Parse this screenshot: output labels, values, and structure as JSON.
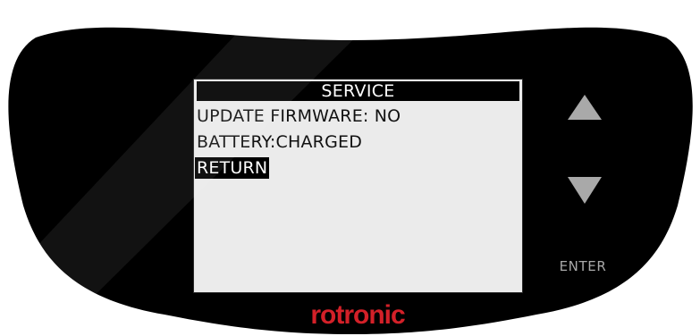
{
  "device": {
    "brand": "rotronic",
    "colors": {
      "bezel": "#000000",
      "screen_bg": "#ebebeb",
      "highlight_bg": "#000000",
      "highlight_text": "#ffffff",
      "button": "#a9a9a9",
      "brand": "#d32028"
    }
  },
  "screen": {
    "title": "SERVICE",
    "items": [
      {
        "label": "UPDATE FIRMWARE: NO",
        "selected": false
      },
      {
        "label": "BATTERY:CHARGED",
        "selected": false
      },
      {
        "label": "RETURN",
        "selected": true
      }
    ]
  },
  "buttons": {
    "up": {
      "icon": "arrow-up-icon"
    },
    "down": {
      "icon": "arrow-down-icon"
    },
    "enter_label": "ENTER"
  }
}
